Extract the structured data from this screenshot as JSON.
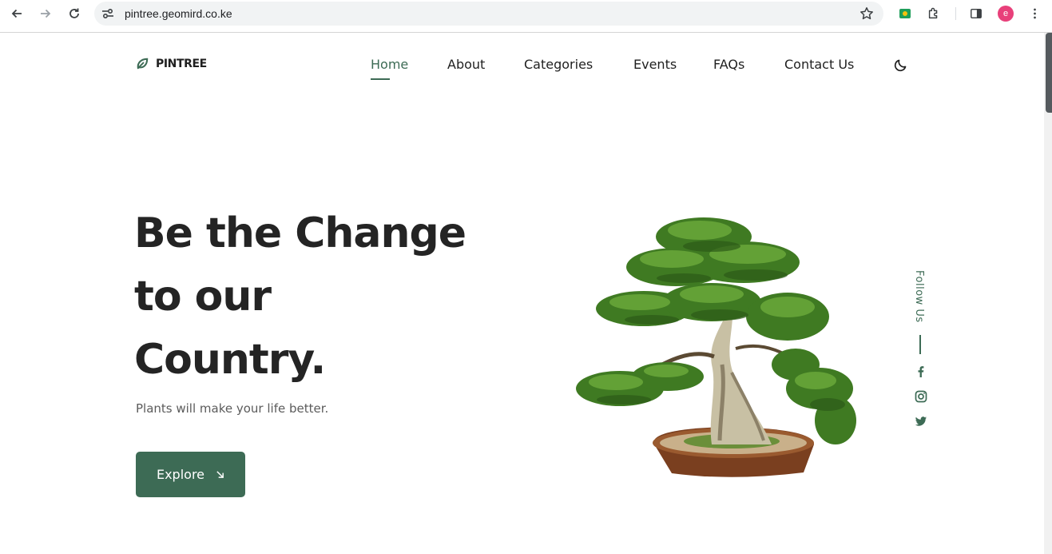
{
  "browser": {
    "url": "pintree.geomird.co.ke",
    "avatar_letter": "e"
  },
  "site": {
    "logo_text": "PINTREE",
    "accent_color": "#3d6b55",
    "nav": {
      "home": "Home",
      "about": "About",
      "categories": "Categories",
      "events": "Events",
      "faqs": "FAQs",
      "contact": "Contact Us",
      "active": "Home"
    },
    "theme_toggle_icon": "moon-icon"
  },
  "hero": {
    "title_line1": "Be the Change",
    "title_line2": "to our",
    "title_line3": "Country.",
    "subtitle": "Plants will make your life better.",
    "cta_label": "Explore",
    "cta_icon": "arrow-down-right-icon",
    "image": "bonsai-tree-image"
  },
  "social": {
    "follow_label": "Follow Us",
    "icons": [
      "facebook-icon",
      "instagram-icon",
      "twitter-icon"
    ]
  }
}
